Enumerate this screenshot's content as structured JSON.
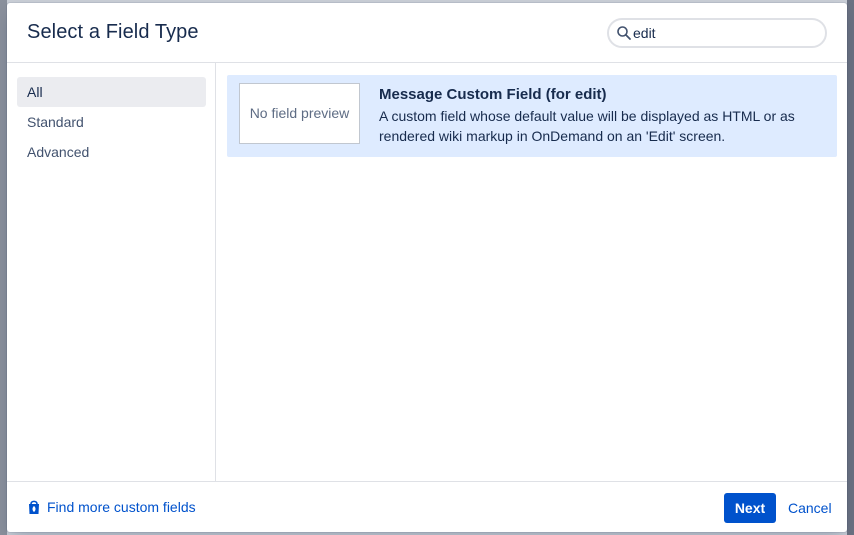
{
  "dialog": {
    "title": "Select a Field Type"
  },
  "search": {
    "value": "edit",
    "placeholder": "",
    "icon": "search-icon"
  },
  "sidebar": {
    "items": [
      {
        "label": "All",
        "active": true
      },
      {
        "label": "Standard",
        "active": false
      },
      {
        "label": "Advanced",
        "active": false
      }
    ]
  },
  "results": [
    {
      "preview_text": "No field preview",
      "name": "Message Custom Field (for edit)",
      "description": "A custom field whose default value will be displayed as HTML or as rendered wiki markup in OnDemand on an 'Edit' screen.",
      "selected": true
    }
  ],
  "footer": {
    "find_link_label": "Find more custom fields",
    "find_link_icon": "marketplace-bag-icon",
    "next_label": "Next",
    "cancel_label": "Cancel"
  },
  "colors": {
    "primary": "#0052cc",
    "selected_bg": "#deebff",
    "text": "#172b4d",
    "overlay": "#5e6c84"
  }
}
